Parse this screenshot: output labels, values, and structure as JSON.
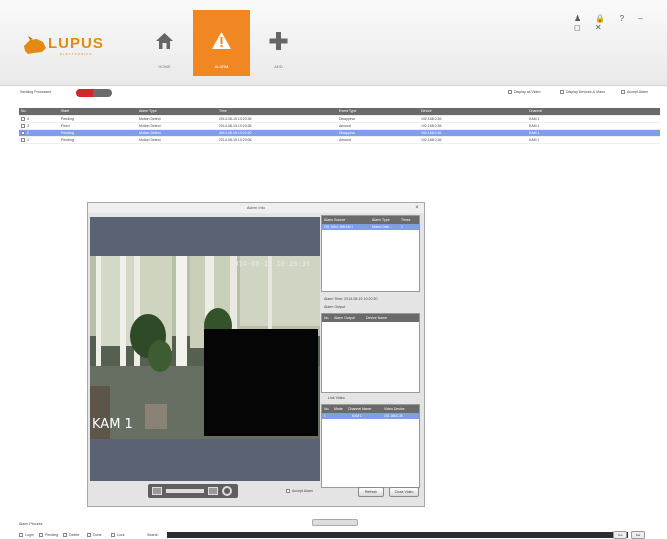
{
  "app": {
    "logo_text": "LUPUS",
    "logo_sub": "ELECTRONICS",
    "nav": [
      {
        "label": "HOME",
        "icon": "home-icon"
      },
      {
        "label": "ALARM",
        "icon": "alarm-icon"
      },
      {
        "label": "ADD",
        "icon": "add-icon"
      }
    ],
    "window_controls": "♟ 🔒 ? – ◻ ✕"
  },
  "toolbar": {
    "sending_label": "Sending Processed",
    "checks": [
      "Display all Video",
      "Display Devices & Video",
      "Accept Alarm"
    ]
  },
  "table": {
    "headers": [
      "No.",
      "State",
      "Alarm Type",
      "Time",
      "Event Type",
      "Device",
      "Channel"
    ],
    "rows": [
      [
        "4",
        "Pending",
        "Motion Detect",
        "2014-08-15 10:20:35",
        "Disappear",
        "192.168.0.36",
        "KAM 1"
      ],
      [
        "3",
        "Fixed",
        "Motion Detect",
        "2014-08-15 10:20:28",
        "Amount",
        "192.168.0.36",
        "KAM 1"
      ],
      [
        "2",
        "Pending",
        "Motion Detect",
        "2014-08-15 10:20:20",
        "Disappear",
        "192.168.0.36",
        "KAM 1"
      ],
      [
        "1",
        "Pending",
        "Motion Detect",
        "2014-08-15 10:20:06",
        "Amount",
        "192.168.0.36",
        "KAM 1"
      ]
    ]
  },
  "dialog": {
    "title": "Alarm Info",
    "close": "×",
    "camera_label": "KAM 1",
    "osd_time": "2014-08-15 10:20:39",
    "alarm_source": {
      "headers": [
        "Alarm Source",
        "Alarm Type",
        "Times"
      ],
      "row": [
        "192.168.0.36/KAM 1",
        "Motion Dete...",
        "1"
      ]
    },
    "alarm_time": "Alarm Time: 2014-08-15 10:20:20",
    "alarm_output_label": "Alarm Output",
    "alarm_output_headers": [
      "No.",
      "Alarm Output",
      "Device Name"
    ],
    "link_video_label": "Link Video",
    "link_video": {
      "headers": [
        "No.",
        "Mode",
        "Channel Name",
        "Video Device"
      ],
      "row": [
        "1",
        "",
        "KAM 1",
        "192.168.0.36"
      ]
    },
    "accept_alarm": "Accept Alarm",
    "buttons": [
      "Refresh",
      "Close Video"
    ]
  },
  "bottom": {
    "label": "Alarm Process",
    "options": [
      "Login",
      "Pending",
      "Delete",
      "Done",
      "Lock"
    ],
    "search": "Search",
    "buttons": [
      "Yes",
      "Set"
    ]
  }
}
